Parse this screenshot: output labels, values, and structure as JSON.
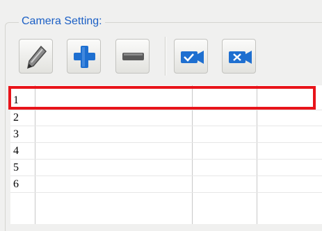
{
  "camera_setting": {
    "title": "Camera Setting:",
    "toolbar": [
      {
        "name": "edit-button",
        "icon": "pencil-icon"
      },
      {
        "name": "add-button",
        "icon": "plus-icon"
      },
      {
        "name": "remove-button",
        "icon": "minus-icon"
      },
      {
        "name": "enable-camera-button",
        "icon": "camera-check-icon"
      },
      {
        "name": "disable-camera-button",
        "icon": "camera-x-icon"
      }
    ],
    "rows": [
      "1",
      "2",
      "3",
      "4",
      "5",
      "6"
    ],
    "selected_row": "1"
  },
  "colors": {
    "title": "#1b5fc5",
    "highlight": "#e8141a",
    "icon_blue": "#1e6fd0",
    "icon_gray": "#5a5a5a"
  }
}
